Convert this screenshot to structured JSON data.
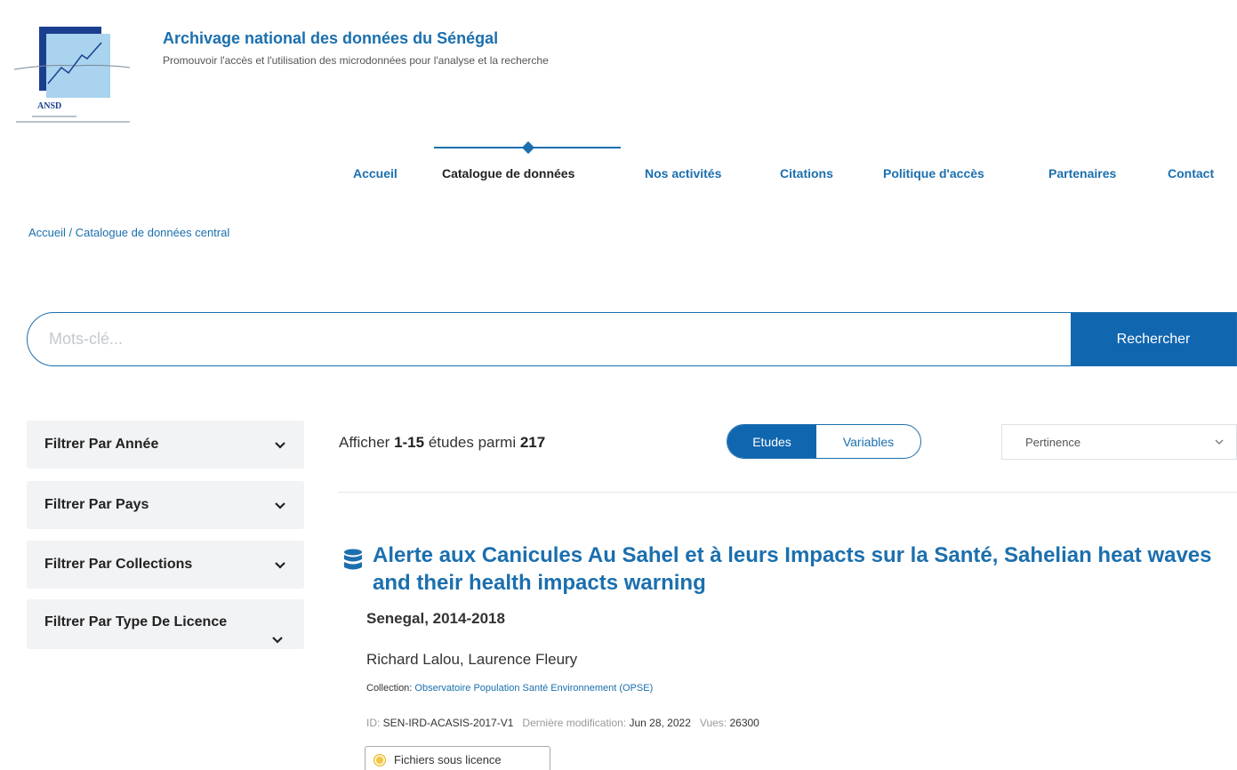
{
  "header": {
    "logo_text": "ANSD",
    "title": "Archivage national des données du Sénégal",
    "tagline": "Promouvoir l'accès et l'utilisation des microdonnées pour l'analyse et la recherche"
  },
  "nav": {
    "items": [
      {
        "label": "Accueil"
      },
      {
        "label": "Catalogue de données"
      },
      {
        "label": "Nos activités"
      },
      {
        "label": "Citations"
      },
      {
        "label": "Politique d'accès"
      },
      {
        "label": "Partenaires"
      },
      {
        "label": "Contact"
      }
    ],
    "active": "Catalogue de données"
  },
  "breadcrumb": {
    "home": "Accueil",
    "separator": " / ",
    "current": "Catalogue de données central"
  },
  "search": {
    "placeholder": "Mots-clé...",
    "button_label": "Rechercher"
  },
  "filters": [
    {
      "label": "Filtrer Par Année"
    },
    {
      "label": "Filtrer Par Pays"
    },
    {
      "label": "Filtrer Par Collections"
    },
    {
      "label": "Filtrer Par Type De Licence"
    }
  ],
  "results": {
    "prefix": "Afficher ",
    "range": "1-15",
    "middle": " études parmi ",
    "total": "217"
  },
  "view_toggle": {
    "studies_label": "Etudes",
    "variables_label": "Variables"
  },
  "sort": {
    "selected": "Pertinence"
  },
  "study": {
    "title": "Alerte aux Canicules Au Sahel et à leurs Impacts sur la Santé, Sahelian heat waves and their health impacts warning",
    "country_years": "Senegal, 2014-2018",
    "authors": "Richard Lalou, Laurence Fleury",
    "collection_label": "Collection: ",
    "collection_value": "Observatoire Population Santé Environnement (OPSE)",
    "id_label": "ID: ",
    "id_value": "SEN-IRD-ACASIS-2017-V1",
    "modified_label": "Dernière modification: ",
    "modified_value": "Jun 28, 2022",
    "views_label": "Vues: ",
    "views_value": "26300",
    "licence_label": "Fichiers sous licence"
  },
  "colors": {
    "primary": "#1b6fae",
    "button": "#1166b0",
    "filter_bg": "#f2f3f5",
    "licence_dot": "#f4c542"
  }
}
